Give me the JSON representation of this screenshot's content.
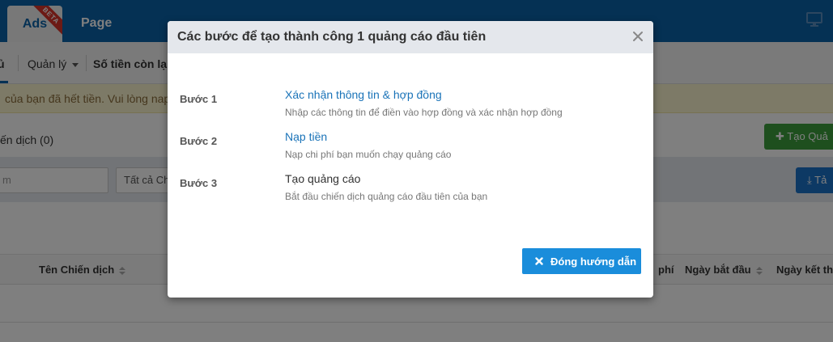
{
  "topbar": {
    "tabs": [
      {
        "label": "Ads",
        "badge": "BETA",
        "active": true
      },
      {
        "label": "Page",
        "active": false
      }
    ],
    "right_icon": "monitor-icon"
  },
  "subnav": {
    "partial_item": "ủ",
    "manage_label": "Quản lý",
    "balance_label": "Số tiền còn lại:"
  },
  "alert": {
    "text": "của bạn đã hết tiền. Vui lòng nap"
  },
  "campaigns": {
    "count_label": "ến dịch (0)",
    "create_button": "Tạo Quả"
  },
  "filters": {
    "search_placeholder": "m",
    "status_select": "Tất cả Ch",
    "export_button": "Tả"
  },
  "table": {
    "headers": [
      "Tên Chiến dịch",
      "phí",
      "Ngày bắt đầu",
      "Ngày kết thú"
    ]
  },
  "modal": {
    "title": "Các bước để tạo thành công 1 quảng cáo đầu tiên",
    "steps": [
      {
        "label": "Bước 1",
        "title": "Xác nhận thông tin & hợp đồng",
        "description": "Nhập các thông tin để điền vào hợp đồng và xác nhận hợp đồng",
        "is_link": true
      },
      {
        "label": "Bước 2",
        "title": "Nạp tiền",
        "description": "Nạp chi phí bạn muốn chạy quảng cáo",
        "is_link": true
      },
      {
        "label": "Bước 3",
        "title": "Tạo quảng cáo",
        "description": "Bắt đầu chiến dịch quảng cáo đầu tiên của bạn",
        "is_link": false
      }
    ],
    "close_button": "Đóng hướng dẫn"
  },
  "colors": {
    "brand_blue": "#0b63a9",
    "link_blue": "#1a73b8",
    "button_blue": "#1a8ddb",
    "create_green": "#3c9e3c",
    "alert_bg": "#fbf5cf"
  }
}
